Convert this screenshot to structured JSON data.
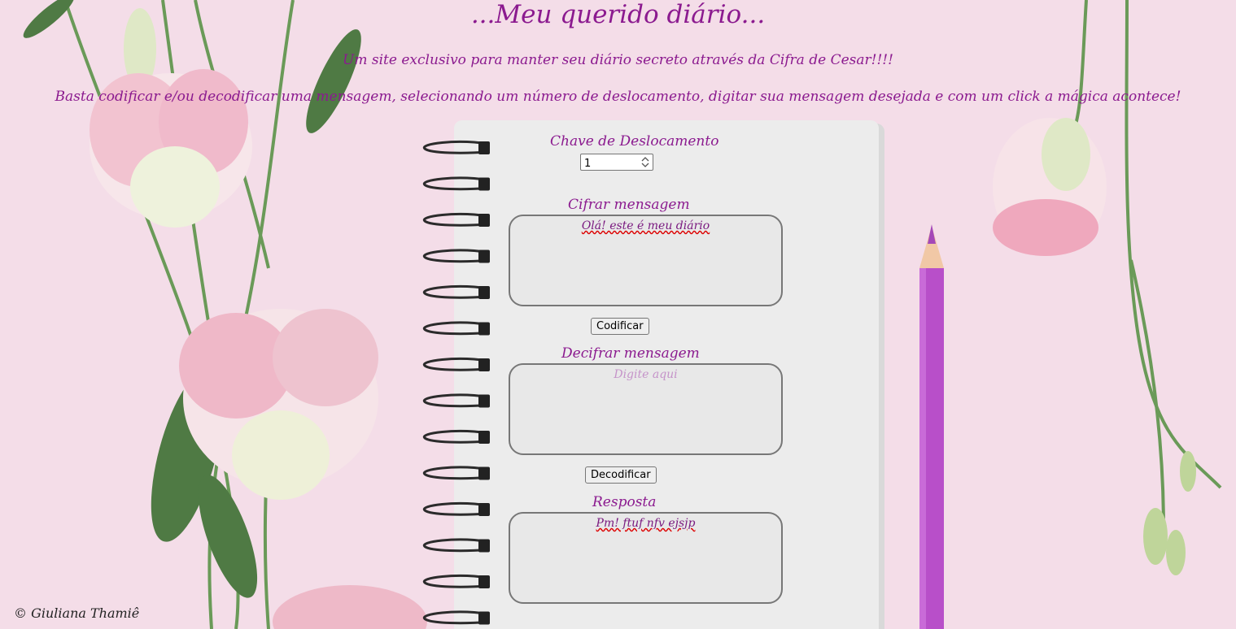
{
  "header": {
    "title": "...Meu querido diário...",
    "subtitle": "Um site exclusivo para manter seu diário secreto através da Cifra de Cesar!!!!",
    "instructions": "Basta codificar e/ou decodificar uma mensagem, selecionando um número de deslocamento, digitar sua mensagem desejada e com um click a mágica acontece!"
  },
  "shift": {
    "label": "Chave de Deslocamento",
    "value": "1"
  },
  "encode": {
    "label": "Cifrar mensagem",
    "value": "Olá! este é meu diário",
    "button": "Codificar"
  },
  "decode": {
    "label": "Decifrar mensagem",
    "placeholder": "Digite aqui",
    "button": "Decodificar"
  },
  "result": {
    "label": "Resposta",
    "value": "Pm! ftuf  nfv ejsjp"
  },
  "footer": {
    "credit": "© Giuliana Thamiê"
  },
  "colors": {
    "accent": "#8b1a8f",
    "background": "#f4dde8",
    "notebook": "#ececec",
    "pencil": "#b84fc9"
  }
}
